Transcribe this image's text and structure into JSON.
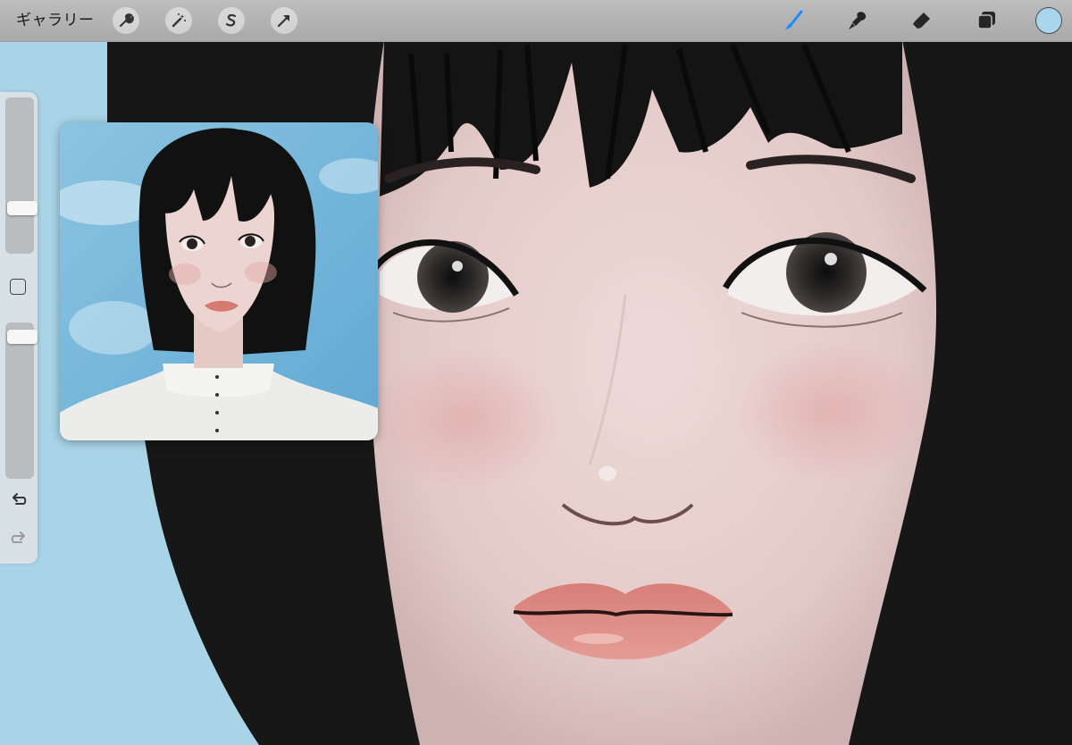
{
  "toolbar": {
    "gallery_label": "ギャラリー",
    "left_tools": [
      {
        "name": "actions",
        "icon": "wrench-icon"
      },
      {
        "name": "adjustments",
        "icon": "magic-wand-icon"
      },
      {
        "name": "selection",
        "icon": "selection-s-icon"
      },
      {
        "name": "transform",
        "icon": "arrow-cursor-icon"
      }
    ],
    "right_tools": [
      {
        "name": "brush",
        "icon": "brush-icon",
        "active": true
      },
      {
        "name": "smudge",
        "icon": "smudge-icon"
      },
      {
        "name": "eraser",
        "icon": "eraser-icon"
      },
      {
        "name": "layers",
        "icon": "layers-icon"
      }
    ],
    "current_color": "#a9d6ec",
    "active_tool_color": "#1e8bff"
  },
  "sidebar": {
    "brush_size_level": 0.73,
    "opacity_level": 0.95,
    "icons": [
      "modify-square-icon",
      "undo-icon",
      "redo-icon"
    ]
  },
  "canvas": {
    "sky_color": "#a9d3e6",
    "skin_color": "#e6cfcd",
    "hair_color": "#141414",
    "lip_color": "#d98580"
  },
  "reference": {
    "sky_color": "#8cc4e0",
    "shirt_color": "#e8e8e6"
  }
}
